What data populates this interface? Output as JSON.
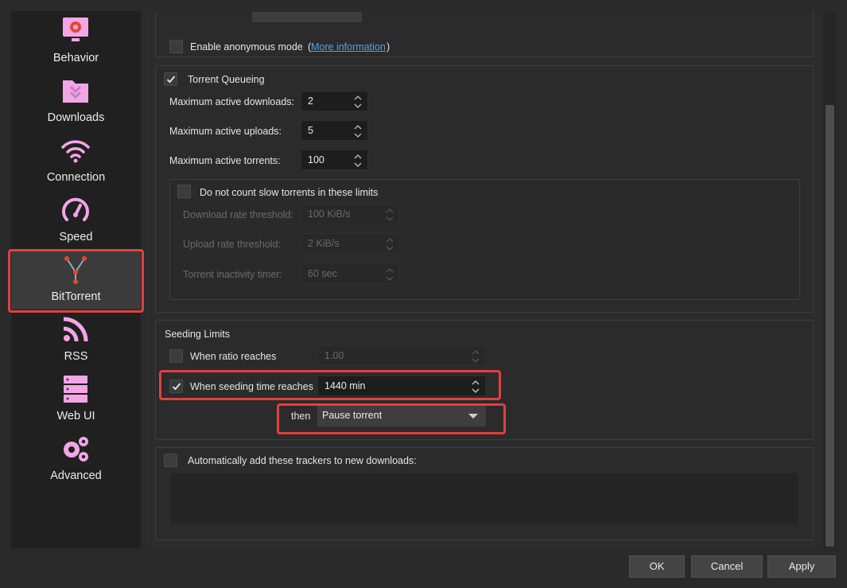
{
  "sidebar": {
    "items": [
      {
        "label": "Behavior",
        "icon": "gear-monitor-icon"
      },
      {
        "label": "Downloads",
        "icon": "download-folder-icon"
      },
      {
        "label": "Connection",
        "icon": "wifi-icon"
      },
      {
        "label": "Speed",
        "icon": "speedometer-icon"
      },
      {
        "label": "BitTorrent",
        "icon": "network-nodes-icon",
        "selected": true
      },
      {
        "label": "RSS",
        "icon": "rss-icon"
      },
      {
        "label": "Web UI",
        "icon": "server-icon"
      },
      {
        "label": "Advanced",
        "icon": "gears-icon"
      }
    ]
  },
  "privacy": {
    "anon_label": "Enable anonymous mode",
    "more_info_prefix": "(",
    "more_info_link": "More information",
    "more_info_suffix": ")"
  },
  "queueing": {
    "title": "Torrent Queueing",
    "checked": true,
    "max_downloads_label": "Maximum active downloads:",
    "max_downloads_value": "2",
    "max_uploads_label": "Maximum active uploads:",
    "max_uploads_value": "5",
    "max_torrents_label": "Maximum active torrents:",
    "max_torrents_value": "100",
    "slow": {
      "title": "Do not count slow torrents in these limits",
      "checked": false,
      "dl_label": "Download rate threshold:",
      "dl_value": "100 KiB/s",
      "ul_label": "Upload rate threshold:",
      "ul_value": "2 KiB/s",
      "timer_label": "Torrent inactivity timer:",
      "timer_value": "60 sec"
    }
  },
  "seeding": {
    "title": "Seeding Limits",
    "ratio_label": "When ratio reaches",
    "ratio_checked": false,
    "ratio_value": "1.00",
    "time_label": "When seeding time reaches",
    "time_checked": true,
    "time_value": "1440 min",
    "then_label": "then",
    "action_value": "Pause torrent"
  },
  "trackers": {
    "label": "Automatically add these trackers to new downloads:",
    "checked": false
  },
  "buttons": {
    "ok": "OK",
    "cancel": "Cancel",
    "apply": "Apply"
  },
  "colors": {
    "accent_highlight": "#e04040",
    "icon_pink": "#f2a6e6",
    "link": "#4fa3e6"
  }
}
